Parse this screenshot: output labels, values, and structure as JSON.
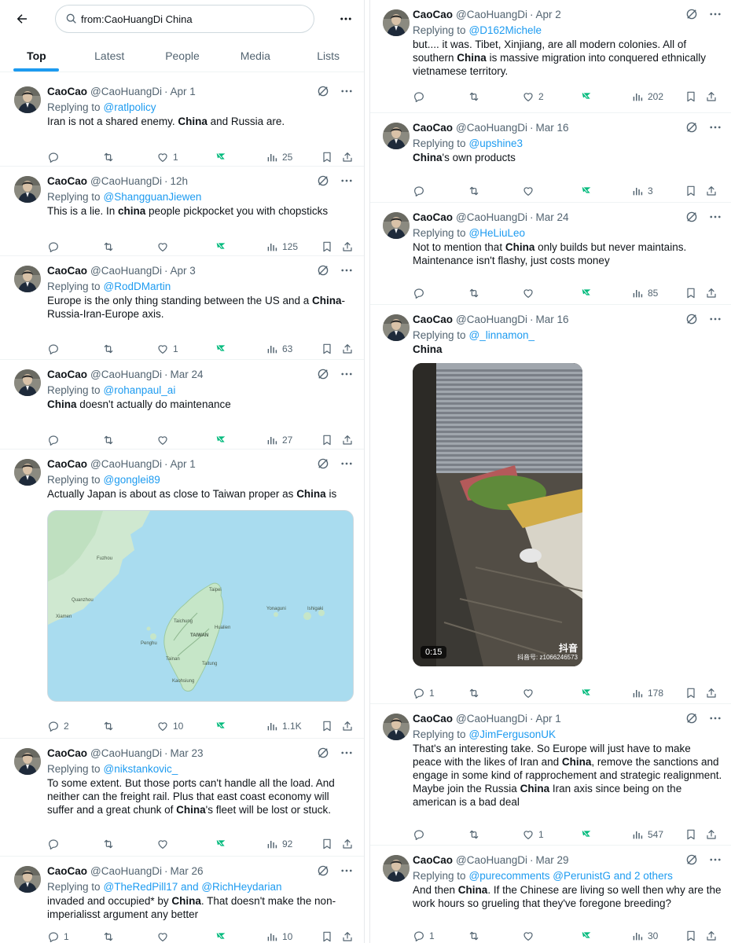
{
  "search": {
    "query": "from:CaoHuangDi China"
  },
  "tabs": [
    "Top",
    "Latest",
    "People",
    "Media",
    "Lists"
  ],
  "colors": {
    "accent": "#1d9bf0",
    "grok": "#00ba7c",
    "text": "#0f1419",
    "muted": "#536471"
  },
  "icons": {
    "back": "arrow-left-icon",
    "search": "search-icon",
    "more": "more-icon",
    "reply": "reply-icon",
    "retweet": "retweet-icon",
    "like": "heart-icon",
    "grok": "grok-icon",
    "views": "views-icon",
    "bookmark": "bookmark-icon",
    "share": "share-icon"
  },
  "left_tweets": [
    {
      "name": "CaoCao",
      "handle": "@CaoHuangDi",
      "sep": "·",
      "time": "Apr 1",
      "reply_prefix": "Replying to",
      "reply_to": "@ratlpolicy",
      "text_parts": [
        "Iran is not a shared enemy. ",
        "China",
        " and Russia are."
      ],
      "counts": {
        "reply": "",
        "retweet": "",
        "like": "1",
        "views": "25"
      }
    },
    {
      "name": "CaoCao",
      "handle": "@CaoHuangDi",
      "sep": "·",
      "time": "12h",
      "reply_prefix": "Replying to",
      "reply_to": "@ShangguanJiewen",
      "text_parts": [
        "This is a lie. In ",
        "china",
        " people pickpocket you with chopsticks"
      ],
      "counts": {
        "reply": "",
        "retweet": "",
        "like": "",
        "views": "125"
      }
    },
    {
      "name": "CaoCao",
      "handle": "@CaoHuangDi",
      "sep": "·",
      "time": "Apr 3",
      "reply_prefix": "Replying to",
      "reply_to": "@RodDMartin",
      "text_parts": [
        "Europe is the only thing standing between the US and a ",
        "China",
        "-Russia-Iran-Europe axis."
      ],
      "counts": {
        "reply": "",
        "retweet": "",
        "like": "1",
        "views": "63"
      }
    },
    {
      "name": "CaoCao",
      "handle": "@CaoHuangDi",
      "sep": "·",
      "time": "Mar 24",
      "reply_prefix": "Replying to",
      "reply_to": "@rohanpaul_ai",
      "text_parts": [
        "",
        "China",
        " doesn't actually do maintenance"
      ],
      "counts": {
        "reply": "",
        "retweet": "",
        "like": "",
        "views": "27"
      }
    },
    {
      "name": "CaoCao",
      "handle": "@CaoHuangDi",
      "sep": "·",
      "time": "Apr 1",
      "reply_prefix": "Replying to",
      "reply_to": "@gonglei89",
      "text_parts": [
        "Actually Japan is about as close to Taiwan proper as ",
        "China",
        " is"
      ],
      "counts": {
        "reply": "2",
        "retweet": "",
        "like": "10",
        "views": "1.1K"
      }
    },
    {
      "name": "CaoCao",
      "handle": "@CaoHuangDi",
      "sep": "·",
      "time": "Mar 23",
      "reply_prefix": "Replying to",
      "reply_to": "@nikstankovic_",
      "text_parts": [
        "To some extent. But those ports can't handle all the load. And neither can the freight rail. Plus that east coast economy will suffer and a great chunk of ",
        "China",
        "'s fleet will be lost or stuck."
      ],
      "counts": {
        "reply": "",
        "retweet": "",
        "like": "",
        "views": "92"
      }
    },
    {
      "name": "CaoCao",
      "handle": "@CaoHuangDi",
      "sep": "·",
      "time": "Mar 26",
      "reply_prefix": "Replying to",
      "reply_to": "@TheRedPill17 and @RichHeydarian",
      "text_parts": [
        "invaded and occupied* by ",
        "China",
        ". That doesn't make the non-imperialisst argument any better"
      ],
      "counts": {
        "reply": "1",
        "retweet": "",
        "like": "",
        "views": "10"
      }
    }
  ],
  "right_tweets": [
    {
      "name": "CaoCao",
      "handle": "@CaoHuangDi",
      "sep": "·",
      "time": "Apr 2",
      "reply_prefix": "Replying to",
      "reply_to": "@D162Michele",
      "text_parts": [
        "but.... it was. Tibet, Xinjiang, are all modern colonies. All of southern ",
        "China",
        " is massive migration into conquered ethnically vietnamese territory."
      ],
      "counts": {
        "reply": "",
        "retweet": "",
        "like": "2",
        "views": "202"
      }
    },
    {
      "name": "CaoCao",
      "handle": "@CaoHuangDi",
      "sep": "·",
      "time": "Mar 16",
      "reply_prefix": "Replying to",
      "reply_to": "@upshine3",
      "text_parts": [
        "",
        "China",
        "'s own products"
      ],
      "counts": {
        "reply": "",
        "retweet": "",
        "like": "",
        "views": "3"
      }
    },
    {
      "name": "CaoCao",
      "handle": "@CaoHuangDi",
      "sep": "·",
      "time": "Mar 24",
      "reply_prefix": "Replying to",
      "reply_to": "@HeLiuLeo",
      "text_parts": [
        "Not to mention that ",
        "China",
        " only builds but never maintains. Maintenance isn't flashy, just costs money"
      ],
      "counts": {
        "reply": "",
        "retweet": "",
        "like": "",
        "views": "85"
      }
    },
    {
      "name": "CaoCao",
      "handle": "@CaoHuangDi",
      "sep": "·",
      "time": "Mar 16",
      "reply_prefix": "Replying to",
      "reply_to": "@_linnamon_",
      "text_parts": [
        "",
        "China",
        ""
      ],
      "video": {
        "duration": "0:15",
        "logo": "抖音",
        "id": "抖音号: z1066246573"
      },
      "counts": {
        "reply": "1",
        "retweet": "",
        "like": "",
        "views": "178"
      }
    },
    {
      "name": "CaoCao",
      "handle": "@CaoHuangDi",
      "sep": "·",
      "time": "Apr 1",
      "reply_prefix": "Replying to",
      "reply_to": "@JimFergusonUK",
      "text_parts": [
        "That's an interesting take. So Europe will just have to make peace with the likes of Iran and ",
        "China",
        ", remove the sanctions and engage in some kind of rapprochement and strategic realignment. Maybe join the Russia ",
        "China",
        " Iran axis since being on the american is a bad deal"
      ],
      "counts": {
        "reply": "",
        "retweet": "",
        "like": "1",
        "views": "547"
      }
    },
    {
      "name": "CaoCao",
      "handle": "@CaoHuangDi",
      "sep": "·",
      "time": "Mar 29",
      "reply_prefix": "Replying to",
      "reply_to": "@purecomments @PerunistG and 2 others",
      "text_parts": [
        "And then ",
        "China",
        ". If the Chinese are living so well then why are the work hours so grueling that they've foregone breeding?"
      ],
      "counts": {
        "reply": "1",
        "retweet": "",
        "like": "",
        "views": "30"
      }
    }
  ],
  "map_labels": [
    "TAIWAN",
    "Taipei",
    "Taichung",
    "Tainan",
    "Kaohsiung",
    "Fuzhou",
    "Xiamen",
    "Quanzhou",
    "Hualien",
    "Taitung",
    "Penghu",
    "Yonaguni",
    "Ishigaki"
  ]
}
